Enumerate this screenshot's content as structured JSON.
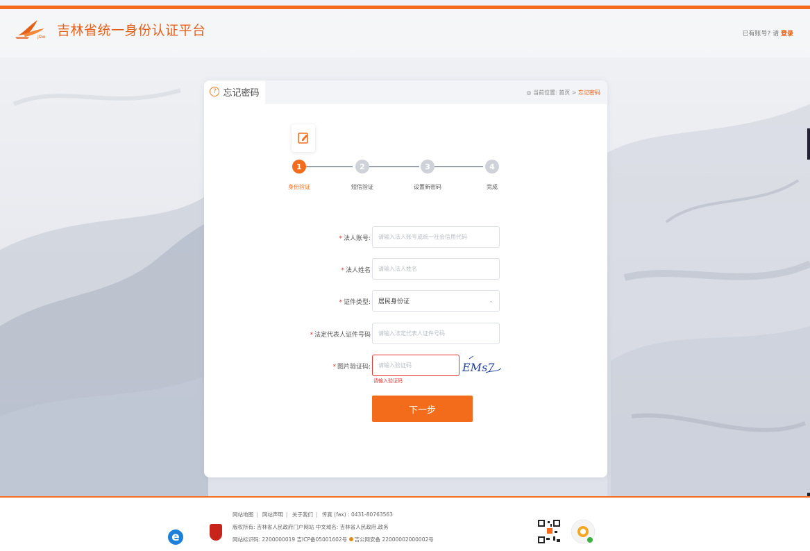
{
  "header": {
    "title": "吉林省统一身份认证平台",
    "login_prompt": "已有账号? 请",
    "login_link": "登录"
  },
  "card": {
    "tab_label": "忘记密码",
    "breadcrumb_prefix": "当前位置: ",
    "breadcrumb_home": "首页",
    "breadcrumb_sep": " > ",
    "breadcrumb_current": "忘记密码"
  },
  "steps": [
    {
      "num": "1",
      "label": "身份验证",
      "state": "active"
    },
    {
      "num": "2",
      "label": "短信验证",
      "state": "inactive"
    },
    {
      "num": "3",
      "label": "设置新密码",
      "state": "inactive"
    },
    {
      "num": "4",
      "label": "完成",
      "state": "inactive"
    }
  ],
  "form": {
    "account_label": "法人账号:",
    "account_placeholder": "请输入法人账号或统一社会信用代码",
    "name_label": "法人姓名",
    "name_placeholder": "请输入法人姓名",
    "id_type_label": "证件类型:",
    "id_type_value": "居民身份证",
    "rep_id_label": "法定代表人证件号码",
    "rep_id_placeholder": "请输入法定代表人证件号码",
    "captcha_label": "图片验证码:",
    "captcha_placeholder": "请输入验证码",
    "captcha_error": "请输入验证码",
    "captcha_text": "EMs7",
    "next_button": "下一步"
  },
  "footer": {
    "links": [
      "网站地图",
      "网站声明",
      "关于我们"
    ],
    "fax": "传真 (fax) : 0431-80763563",
    "copyright": "版权所有: 吉林省人民政府门户网站  中文域名: 吉林省人民政府.政务",
    "site_code": "网站标识码: 2200000019  吉ICP备05001602号",
    "police": "吉公网安备 22000002000002号"
  },
  "colors": {
    "accent": "#f26c1b",
    "error": "#e5322d"
  }
}
